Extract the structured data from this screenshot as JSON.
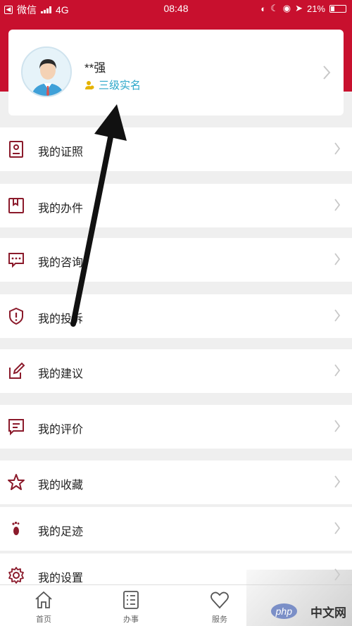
{
  "status_bar": {
    "carrier": "微信",
    "network": "4G",
    "time": "08:48",
    "battery": "21%"
  },
  "profile": {
    "name": "**强",
    "verify_level": "三级实名"
  },
  "menu": [
    {
      "label": "我的证照",
      "icon": "id-card-icon"
    },
    {
      "label": "我的办件",
      "icon": "bookmark-icon"
    },
    {
      "label": "我的咨询",
      "icon": "chat-bubble-icon"
    },
    {
      "label": "我的投诉",
      "icon": "shield-icon"
    },
    {
      "label": "我的建议",
      "icon": "edit-icon"
    },
    {
      "label": "我的评价",
      "icon": "comment-icon"
    },
    {
      "label": "我的收藏",
      "icon": "star-icon"
    },
    {
      "label": "我的足迹",
      "icon": "footprint-icon"
    },
    {
      "label": "我的设置",
      "icon": "gear-icon"
    }
  ],
  "tabs": [
    {
      "label": "首页",
      "icon": "home-icon"
    },
    {
      "label": "办事",
      "icon": "list-icon"
    },
    {
      "label": "服务",
      "icon": "heart-icon"
    }
  ],
  "watermark": {
    "logo": "php",
    "text": "中文网"
  },
  "colors": {
    "brand_red": "#c8102e",
    "accent_icon": "#8b1a2b",
    "verify_blue": "#2aa6c9"
  }
}
